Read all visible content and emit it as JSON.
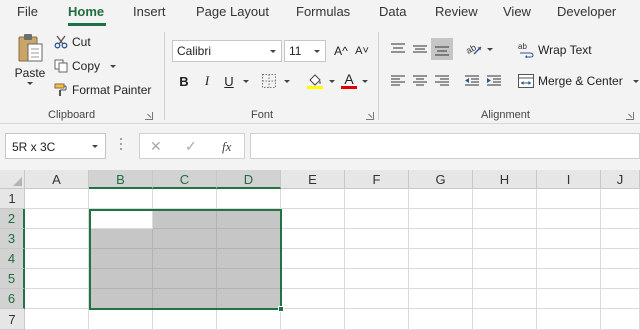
{
  "tabs": [
    "File",
    "Home",
    "Insert",
    "Page Layout",
    "Formulas",
    "Data",
    "Review",
    "View",
    "Developer"
  ],
  "active_tab": "Home",
  "clipboard": {
    "paste_label": "Paste",
    "cut_label": "Cut",
    "copy_label": "Copy",
    "format_painter_label": "Format Painter",
    "group_label": "Clipboard"
  },
  "font": {
    "font_name": "Calibri",
    "font_size": "11",
    "group_label": "Font",
    "grow_icon": "A^",
    "shrink_icon": "A˅",
    "bold": "B",
    "italic": "I",
    "underline": "U",
    "font_color_letter": "A",
    "highlight_color": "#ffff00",
    "font_color": "#e00000"
  },
  "alignment": {
    "wrap_text_label": "Wrap Text",
    "merge_center_label": "Merge & Center",
    "group_label": "Alignment"
  },
  "formula_bar": {
    "name_box": "5R x 3C",
    "cancel_icon": "✕",
    "enter_icon": "✓",
    "fx_label": "fx",
    "formula_value": ""
  },
  "sheet": {
    "columns": [
      "A",
      "B",
      "C",
      "D",
      "E",
      "F",
      "G",
      "H",
      "I",
      "J"
    ],
    "rows": [
      "1",
      "2",
      "3",
      "4",
      "5",
      "6",
      "7"
    ],
    "selection": "B2:D6",
    "active_cell": "B2"
  },
  "colors": {
    "accent": "#217346",
    "selection_fill": "#c6c6c6",
    "ribbon_bg": "#f3f3f3"
  }
}
